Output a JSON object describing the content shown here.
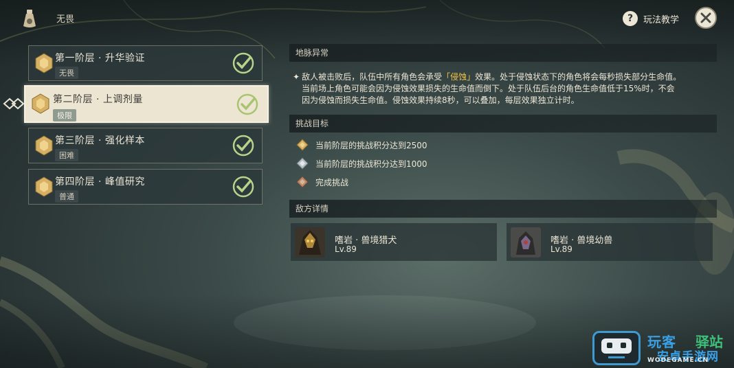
{
  "header": {
    "mode_title": "无畏",
    "help_label": "玩法教学"
  },
  "stages": [
    {
      "title": "第一阶层 · 升华验证",
      "tag": "无畏",
      "completed": true,
      "active": false
    },
    {
      "title": "第二阶层 · 上调剂量",
      "tag": "极限",
      "completed": true,
      "active": true
    },
    {
      "title": "第三阶层 · 强化样本",
      "tag": "困难",
      "completed": true,
      "active": false
    },
    {
      "title": "第四阶层 · 峰值研究",
      "tag": "普通",
      "completed": true,
      "active": false
    }
  ],
  "ley_line": {
    "header": "地脉异常",
    "desc_part1": "敌人被击败后，队伍中所有角色会承受",
    "desc_highlight": "「侵蚀」",
    "desc_part2": "效果。处于侵蚀状态下的角色将会每秒损失部分生命值。",
    "desc_line2": "当前场上角色可能会因为侵蚀效果损失的生命值而倒下。处于队伍后台的角色生命值低于15%时，不会",
    "desc_line3": "因为侵蚀而损失生命值。侵蚀效果持续8秒，可以叠加，每层效果独立计时。"
  },
  "challenge": {
    "header": "挑战目标",
    "goals": [
      {
        "text": "当前阶层的挑战积分达到2500",
        "icon": "gold-badge-icon"
      },
      {
        "text": "当前阶层的挑战积分达到1000",
        "icon": "silver-badge-icon"
      },
      {
        "text": "完成挑战",
        "icon": "bronze-badge-icon"
      }
    ]
  },
  "enemies": {
    "header": "敌方详情",
    "list": [
      {
        "name": "嗜岩 · 兽境猎犬",
        "level": "Lv.89"
      },
      {
        "name": "嗜岩 · 兽境幼兽",
        "level": "Lv.89"
      }
    ]
  },
  "watermark": {
    "t1": "玩客",
    "t2": "驿站",
    "t3": "安卓手游网",
    "url": "WODEGAME.CN"
  },
  "colors": {
    "accent_gold": "#f0c24a",
    "check_green": "#b9d48a",
    "panel_dark": "#2c383a"
  }
}
